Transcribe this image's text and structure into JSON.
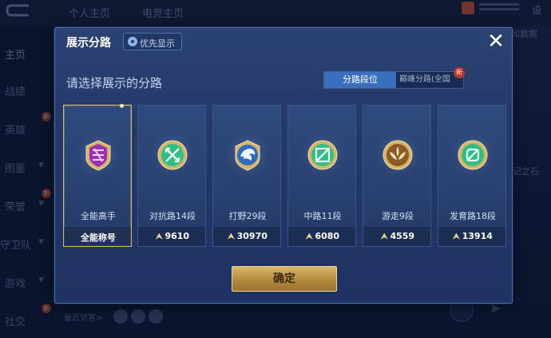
{
  "background": {
    "tabs": [
      "个人主页",
      "电竞主页"
    ],
    "right_top_label": "设",
    "right_mid_label": "和数据",
    "right_side_label": "记之石",
    "sidebar_items": [
      "主页",
      "战绩",
      "英雄",
      "图鉴",
      "荣誉",
      "守卫队",
      "游戏",
      "社交"
    ],
    "new_badge": "新",
    "recent_visitors": "最近访客>"
  },
  "dialog": {
    "title": "展示分路",
    "priority_label": "优先显示",
    "close_symbol": "✕",
    "subtitle": "请选择展示的分路",
    "segment_tab_1": "分路段位",
    "segment_tab_2": "巅峰分路(全国",
    "segment_new_badge": "新",
    "cards": [
      {
        "name": "全能高手",
        "value": "全能称号",
        "emblem": "all-round-emblem",
        "color": "#b23ec9",
        "selected": true
      },
      {
        "name": "对抗路14段",
        "value": "9610",
        "emblem": "clash-lane-emblem",
        "color": "#2fbf86",
        "selected": false
      },
      {
        "name": "打野29段",
        "value": "30970",
        "emblem": "jungle-emblem",
        "color": "#3a7fd8",
        "selected": false
      },
      {
        "name": "中路11段",
        "value": "6080",
        "emblem": "mid-lane-emblem",
        "color": "#2fbf86",
        "selected": false
      },
      {
        "name": "游走9段",
        "value": "4559",
        "emblem": "roam-emblem",
        "color": "#b9823a",
        "selected": false
      },
      {
        "name": "发育路18段",
        "value": "13914",
        "emblem": "farm-lane-emblem",
        "color": "#2fbf86",
        "selected": false
      }
    ],
    "points_arrow": "⮝",
    "confirm_label": "确定"
  }
}
